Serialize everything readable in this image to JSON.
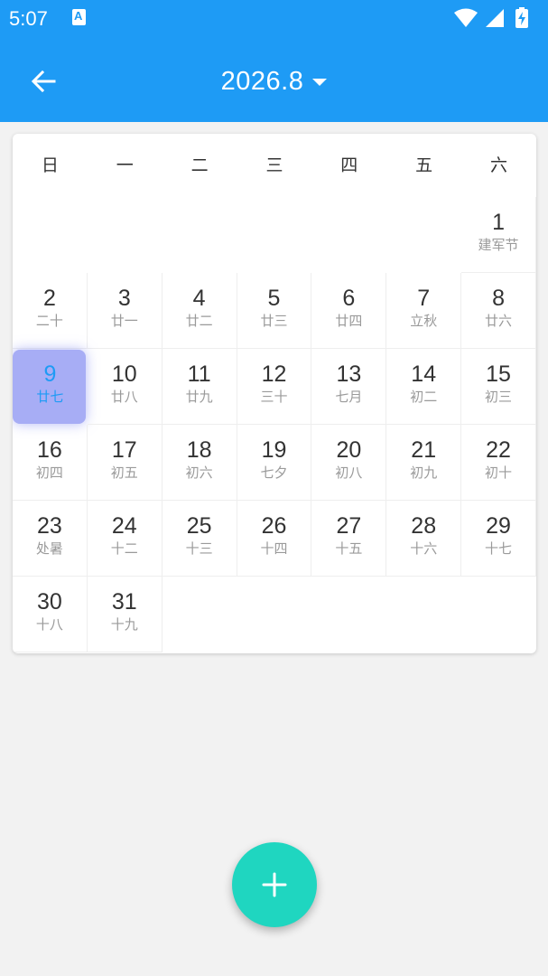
{
  "status": {
    "time": "5:07",
    "icons": [
      "notification-a-icon",
      "wifi-icon",
      "signal-icon",
      "battery-charging-icon"
    ]
  },
  "header": {
    "back_icon": "arrow-left-icon",
    "title": "2026.8",
    "dropdown_icon": "caret-down-icon",
    "color": "#1e9bf5"
  },
  "calendar": {
    "weekdays": [
      "日",
      "一",
      "二",
      "三",
      "四",
      "五",
      "六"
    ],
    "first_weekday_index": 6,
    "selected_day": 9,
    "selected_color": "#a7adf5",
    "days": [
      {
        "day": "1",
        "lunar": "建军节"
      },
      {
        "day": "2",
        "lunar": "二十"
      },
      {
        "day": "3",
        "lunar": "廿一"
      },
      {
        "day": "4",
        "lunar": "廿二"
      },
      {
        "day": "5",
        "lunar": "廿三"
      },
      {
        "day": "6",
        "lunar": "廿四"
      },
      {
        "day": "7",
        "lunar": "立秋"
      },
      {
        "day": "8",
        "lunar": "廿六"
      },
      {
        "day": "9",
        "lunar": "廿七"
      },
      {
        "day": "10",
        "lunar": "廿八"
      },
      {
        "day": "11",
        "lunar": "廿九"
      },
      {
        "day": "12",
        "lunar": "三十"
      },
      {
        "day": "13",
        "lunar": "七月"
      },
      {
        "day": "14",
        "lunar": "初二"
      },
      {
        "day": "15",
        "lunar": "初三"
      },
      {
        "day": "16",
        "lunar": "初四"
      },
      {
        "day": "17",
        "lunar": "初五"
      },
      {
        "day": "18",
        "lunar": "初六"
      },
      {
        "day": "19",
        "lunar": "七夕"
      },
      {
        "day": "20",
        "lunar": "初八"
      },
      {
        "day": "21",
        "lunar": "初九"
      },
      {
        "day": "22",
        "lunar": "初十"
      },
      {
        "day": "23",
        "lunar": "处暑"
      },
      {
        "day": "24",
        "lunar": "十二"
      },
      {
        "day": "25",
        "lunar": "十三"
      },
      {
        "day": "26",
        "lunar": "十四"
      },
      {
        "day": "27",
        "lunar": "十五"
      },
      {
        "day": "28",
        "lunar": "十六"
      },
      {
        "day": "29",
        "lunar": "十七"
      },
      {
        "day": "30",
        "lunar": "十八"
      },
      {
        "day": "31",
        "lunar": "十九"
      }
    ]
  },
  "fab": {
    "icon": "plus-icon",
    "color": "#1fd6c0"
  }
}
